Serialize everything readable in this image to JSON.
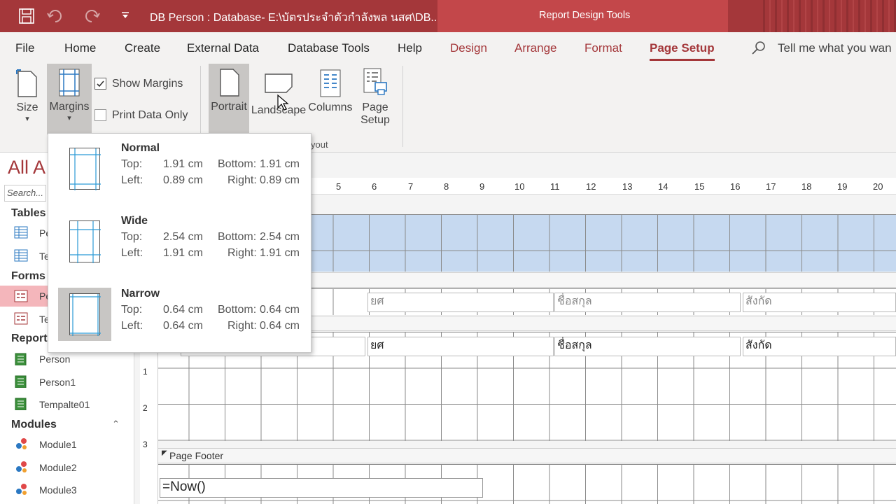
{
  "titlebar": {
    "title": "DB Person : Database- E:\\บัตรประจำตัวกำลังพล นสศ\\DB...",
    "context_label": "Report Design Tools"
  },
  "tabs": [
    "File",
    "Home",
    "Create",
    "External Data",
    "Database Tools",
    "Help",
    "Design",
    "Arrange",
    "Format",
    "Page Setup"
  ],
  "tell_me": "Tell me what you wan",
  "ribbon": {
    "size": "Size",
    "margins": "Margins",
    "show_margins": "Show Margins",
    "print_data_only": "Print Data Only",
    "portrait": "Portrait",
    "landscape": "Landscape",
    "columns": "Columns",
    "page_setup_1": "Page",
    "page_setup_2": "Setup",
    "group_layout": "yout"
  },
  "margins_menu": [
    {
      "name": "Normal",
      "top": "1.91 cm",
      "bottom": "1.91 cm",
      "left": "0.89 cm",
      "right": "0.89 cm"
    },
    {
      "name": "Wide",
      "top": "2.54 cm",
      "bottom": "2.54 cm",
      "left": "1.91 cm",
      "right": "1.91 cm"
    },
    {
      "name": "Narrow",
      "top": "0.64 cm",
      "bottom": "0.64 cm",
      "left": "0.64 cm",
      "right": "0.64 cm"
    }
  ],
  "margin_labels": {
    "top": "Top:",
    "bottom": "Bottom:",
    "left": "Left:",
    "right": "Right:"
  },
  "nav": {
    "header": "All A",
    "search": "Search...",
    "tables": "Tables",
    "table_items": [
      "Pe",
      "Te"
    ],
    "forms": "Forms",
    "form_items": [
      "Pe",
      "Te"
    ],
    "reports": "Report",
    "report_items": [
      "Person",
      "Person1",
      "Tempalte01"
    ],
    "modules": "Modules",
    "module_items": [
      "Module1",
      "Module2",
      "Module3"
    ]
  },
  "ruler": [
    "5",
    "6",
    "7",
    "8",
    "9",
    "10",
    "11",
    "12",
    "13",
    "14",
    "15",
    "16",
    "17",
    "18",
    "19",
    "20"
  ],
  "vruler": [
    "1",
    "2",
    "3"
  ],
  "labels": {
    "rank": "ยศ",
    "surname": "ชื่อสกุล",
    "unit": "สังกัด"
  },
  "fields": {
    "rank": "ยศ",
    "surname": "ชื่อสกุล",
    "unit": "สังกัด"
  },
  "page_footer": "Page Footer",
  "now_expr": "=Now()",
  "colors": {
    "accent": "#a4373a",
    "header_fill": "#c6d9f0"
  }
}
